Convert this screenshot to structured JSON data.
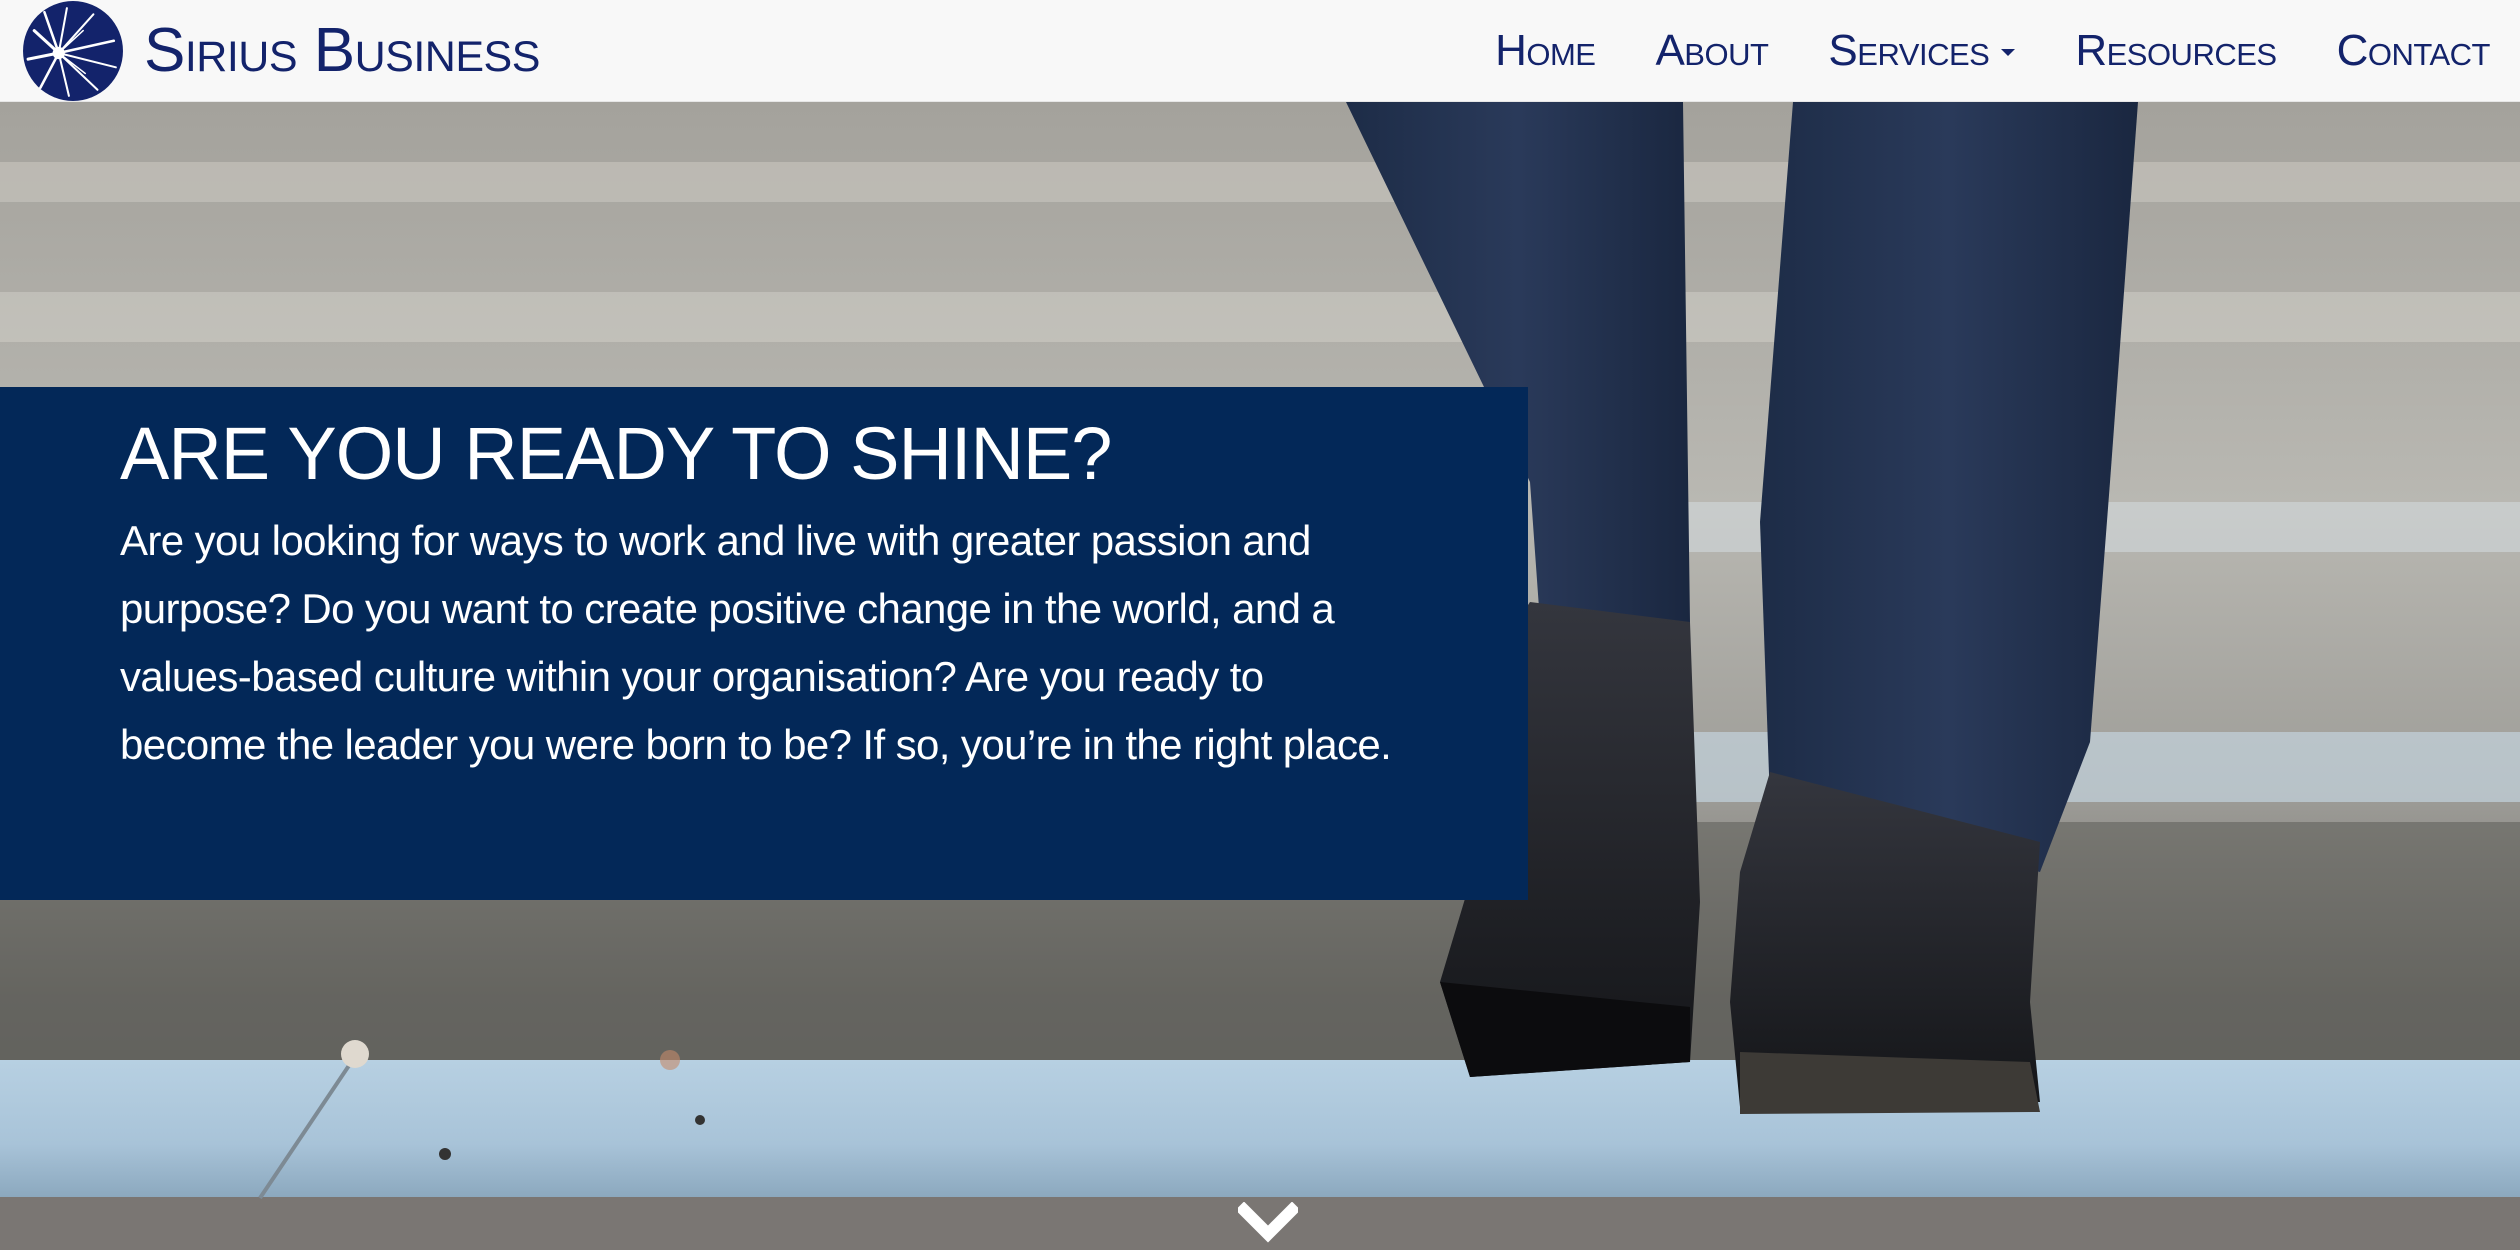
{
  "brand": {
    "name": "Sirius Business",
    "logo_icon": "starburst-circle-icon",
    "color": "#13236b"
  },
  "nav": {
    "items": [
      {
        "label": "Home"
      },
      {
        "label": "About"
      },
      {
        "label": "Services",
        "has_dropdown": true
      },
      {
        "label": "Resources"
      },
      {
        "label": "Contact"
      }
    ]
  },
  "hero": {
    "title": "ARE YOU READY TO SHINE?",
    "text": "Are you looking for ways to work and live with greater passion and purpose? Do you want to create positive change in the world, and a values-based culture within your organisation? Are you ready to become the leader you were born to be? If so, you’re in the right place.",
    "panel_color": "#032858",
    "background_image": "walking-up-stone-steps-photo",
    "scroll_icon": "chevron-down-icon"
  }
}
